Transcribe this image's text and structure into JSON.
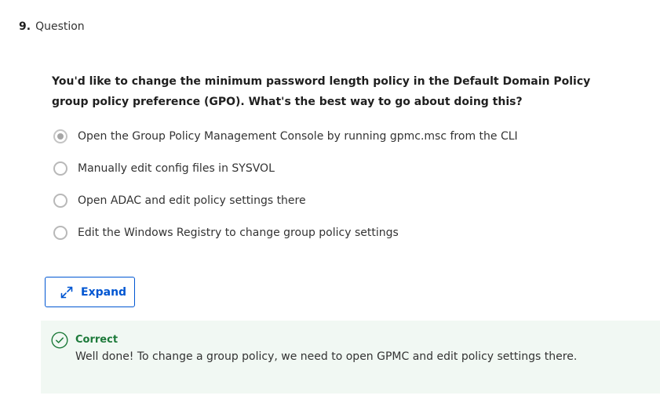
{
  "question": {
    "number": "9.",
    "type_label": "Question",
    "text": "You'd like to change the minimum password length policy in the Default Domain Policy group policy preference (GPO). What's the best way to go about doing this?",
    "options": [
      {
        "label": "Open the Group Policy Management Console by running gpmc.msc from the CLI",
        "selected": true
      },
      {
        "label": "Manually edit config files in SYSVOL",
        "selected": false
      },
      {
        "label": "Open ADAC and edit policy settings there",
        "selected": false
      },
      {
        "label": "Edit the Windows Registry to change group policy settings",
        "selected": false
      }
    ]
  },
  "expand_button": {
    "label": "Expand",
    "icon": "expand-arrows-icon"
  },
  "feedback": {
    "status": "Correct",
    "icon": "check-circle-icon",
    "message": "Well done! To change a group policy, we need to open GPMC and edit policy settings there."
  },
  "colors": {
    "accent": "#0056d2",
    "success": "#1d7a3a",
    "feedback_bg": "#f1f8f3"
  }
}
